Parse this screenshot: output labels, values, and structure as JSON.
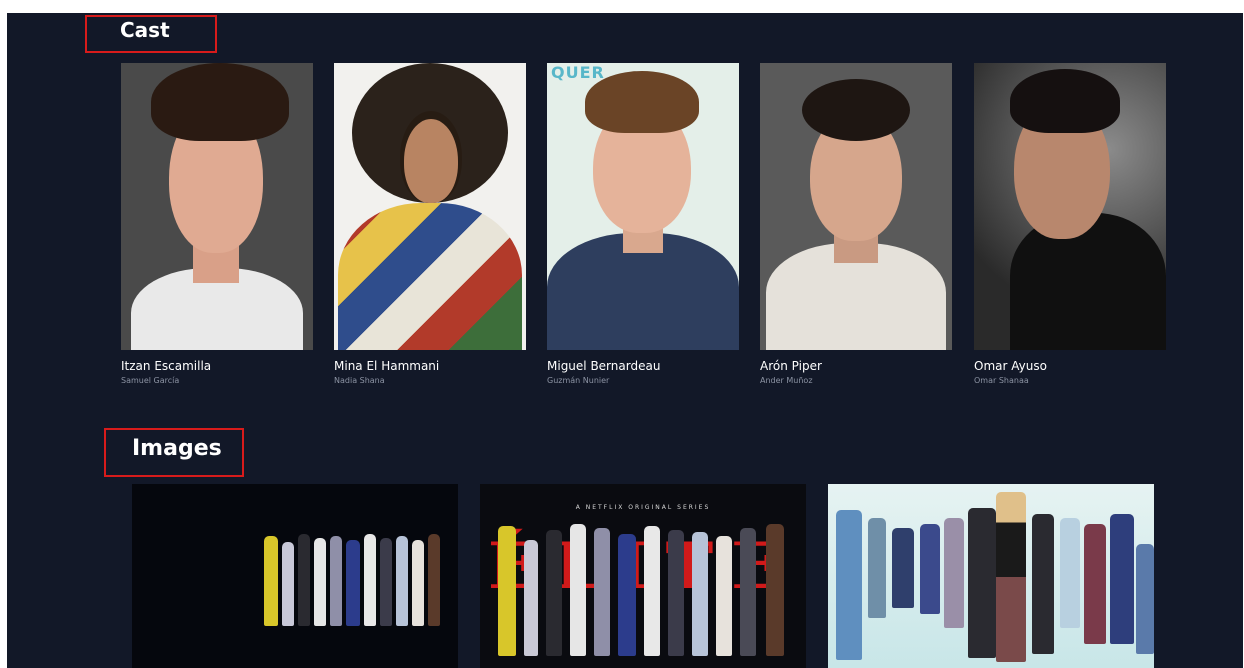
{
  "sections": {
    "cast_title": "Cast",
    "images_title": "Images"
  },
  "cast": [
    {
      "name": "Itzan Escamilla",
      "role": "Samuel García"
    },
    {
      "name": "Mina El Hammani",
      "role": "Nadia Shana"
    },
    {
      "name": "Miguel Bernardeau",
      "role": "Guzmán Nunier"
    },
    {
      "name": "Arón Piper",
      "role": "Ander Muñoz"
    },
    {
      "name": "Omar Ayuso",
      "role": "Omar Shanaa"
    }
  ],
  "images": [
    {
      "banner_small": "",
      "banner_title": ""
    },
    {
      "banner_small": "A NETFLIX ORIGINAL SERIES",
      "banner_title": "ÉLITE"
    },
    {
      "banner_small": "",
      "banner_title": ""
    }
  ],
  "colors": {
    "background": "#121828",
    "highlight_box": "#d81b1b"
  }
}
